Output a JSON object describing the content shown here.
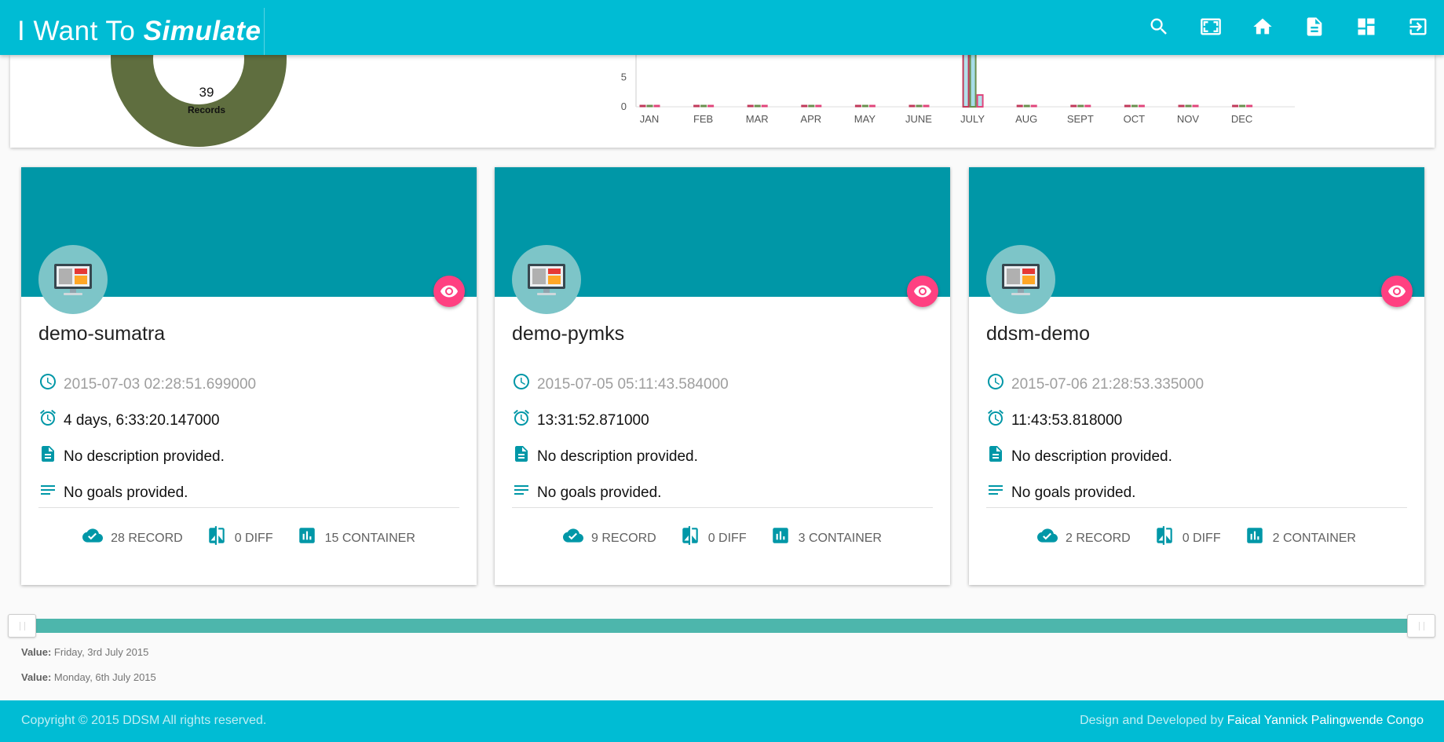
{
  "header": {
    "brand_prefix": "I Want To",
    "brand_emphasis": "Simulate",
    "icons": [
      "search-icon",
      "fullscreen-icon",
      "home-icon",
      "document-icon",
      "dashboard-icon",
      "logout-icon"
    ]
  },
  "summary": {
    "donut": {
      "value": "39",
      "label": "Records",
      "color": "#5f6e3f"
    },
    "chart_data": {
      "type": "bar",
      "categories": [
        "JAN",
        "FEB",
        "MAR",
        "APR",
        "MAY",
        "JUNE",
        "JULY",
        "AUG",
        "SEPT",
        "OCT",
        "NOV",
        "DEC"
      ],
      "series": [
        {
          "values": [
            0,
            0,
            0,
            0,
            0,
            0,
            39,
            0,
            0,
            0,
            0,
            0
          ],
          "color": "#c0395a"
        },
        {
          "values": [
            0,
            0,
            0,
            0,
            0,
            0,
            39,
            0,
            0,
            0,
            0,
            0
          ],
          "color": "#6a8f4f"
        },
        {
          "values": [
            0,
            0,
            0,
            0,
            0,
            0,
            2,
            0,
            0,
            0,
            0,
            0
          ],
          "color": "#e0457b"
        }
      ],
      "yticks": [
        "0",
        "5"
      ],
      "ylim": [
        0,
        39
      ]
    }
  },
  "cards": [
    {
      "title": "demo-sumatra",
      "date": "2015-07-03 02:28:51.699000",
      "duration": "4 days, 6:33:20.147000",
      "description": "No description provided.",
      "goals": "No goals provided.",
      "record": "28 RECORD",
      "diff": "0 DIFF",
      "container": "15 CONTAINER"
    },
    {
      "title": "demo-pymks",
      "date": "2015-07-05 05:11:43.584000",
      "duration": "13:31:52.871000",
      "description": "No description provided.",
      "goals": "No goals provided.",
      "record": "9 RECORD",
      "diff": "0 DIFF",
      "container": "3 CONTAINER"
    },
    {
      "title": "ddsm-demo",
      "date": "2015-07-06 21:28:53.335000",
      "duration": "11:43:53.818000",
      "description": "No description provided.",
      "goals": "No goals provided.",
      "record": "2 RECORD",
      "diff": "0 DIFF",
      "container": "2 CONTAINER"
    }
  ],
  "slider": {
    "range": [
      0,
      1
    ],
    "value_label": "Value:",
    "start": "Friday, 3rd July 2015",
    "end": "Monday, 6th July 2015"
  },
  "footer": {
    "copyright": "Copyright © 2015 DDSM All rights reserved.",
    "credit_prefix": "Design and Developed by",
    "credit_name": "Faical Yannick Palingwende Congo"
  },
  "colors": {
    "primary": "#00bcd4",
    "card_banner": "#0097a7",
    "accent": "#ff4081",
    "slider": "#4db6ac"
  }
}
